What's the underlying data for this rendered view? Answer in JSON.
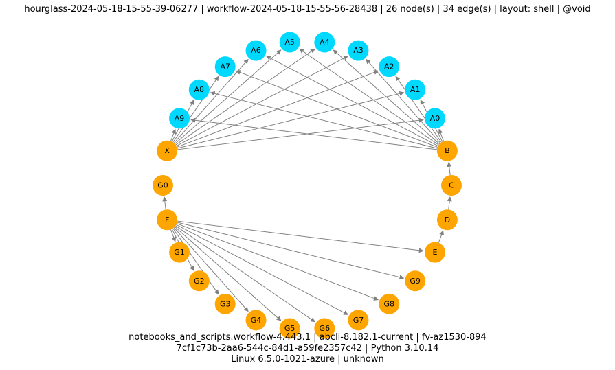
{
  "title": "hourglass-2024-05-18-15-55-39-06277 | workflow-2024-05-18-15-55-56-28438 | 26 node(s) | 34 edge(s) | layout: shell | @void",
  "footer1": "notebooks_and_scripts.workflow-4.443.1 | abcli-8.182.1-current | fv-az1530-894",
  "footer2": "7cf1c73b-2aa6-544c-84d1-a59fe2357c42 | Python 3.10.14",
  "footer3": "Linux 6.5.0-1021-azure | unknown",
  "colors": {
    "cyan": "#00d9ff",
    "orange": "#ffa500",
    "edge": "#808080"
  },
  "chart_data": {
    "type": "table",
    "layout": "shell",
    "node_count": 26,
    "edge_count": 34,
    "nodes": [
      {
        "id": "A4",
        "group": "cyan"
      },
      {
        "id": "A3",
        "group": "cyan"
      },
      {
        "id": "A2",
        "group": "cyan"
      },
      {
        "id": "A1",
        "group": "cyan"
      },
      {
        "id": "A0",
        "group": "cyan"
      },
      {
        "id": "B",
        "group": "orange"
      },
      {
        "id": "C",
        "group": "orange"
      },
      {
        "id": "D",
        "group": "orange"
      },
      {
        "id": "E",
        "group": "orange"
      },
      {
        "id": "G9",
        "group": "orange"
      },
      {
        "id": "G8",
        "group": "orange"
      },
      {
        "id": "G7",
        "group": "orange"
      },
      {
        "id": "G6",
        "group": "orange"
      },
      {
        "id": "G5",
        "group": "orange"
      },
      {
        "id": "G4",
        "group": "orange"
      },
      {
        "id": "G3",
        "group": "orange"
      },
      {
        "id": "G2",
        "group": "orange"
      },
      {
        "id": "G1",
        "group": "orange"
      },
      {
        "id": "F",
        "group": "orange"
      },
      {
        "id": "G0",
        "group": "orange"
      },
      {
        "id": "X",
        "group": "orange"
      },
      {
        "id": "A9",
        "group": "cyan"
      },
      {
        "id": "A8",
        "group": "cyan"
      },
      {
        "id": "A7",
        "group": "cyan"
      },
      {
        "id": "A6",
        "group": "cyan"
      },
      {
        "id": "A5",
        "group": "cyan"
      }
    ],
    "edges": [
      {
        "from": "B",
        "to": "A0"
      },
      {
        "from": "B",
        "to": "A1"
      },
      {
        "from": "B",
        "to": "A2"
      },
      {
        "from": "B",
        "to": "A3"
      },
      {
        "from": "B",
        "to": "A4"
      },
      {
        "from": "B",
        "to": "A5"
      },
      {
        "from": "B",
        "to": "A6"
      },
      {
        "from": "B",
        "to": "A7"
      },
      {
        "from": "B",
        "to": "A8"
      },
      {
        "from": "B",
        "to": "A9"
      },
      {
        "from": "C",
        "to": "B"
      },
      {
        "from": "D",
        "to": "C"
      },
      {
        "from": "E",
        "to": "D"
      },
      {
        "from": "F",
        "to": "E"
      },
      {
        "from": "F",
        "to": "G0"
      },
      {
        "from": "F",
        "to": "G1"
      },
      {
        "from": "F",
        "to": "G2"
      },
      {
        "from": "F",
        "to": "G3"
      },
      {
        "from": "F",
        "to": "G4"
      },
      {
        "from": "F",
        "to": "G5"
      },
      {
        "from": "F",
        "to": "G6"
      },
      {
        "from": "F",
        "to": "G7"
      },
      {
        "from": "F",
        "to": "G8"
      },
      {
        "from": "F",
        "to": "G9"
      },
      {
        "from": "X",
        "to": "A0"
      },
      {
        "from": "X",
        "to": "A1"
      },
      {
        "from": "X",
        "to": "A2"
      },
      {
        "from": "X",
        "to": "A3"
      },
      {
        "from": "X",
        "to": "A4"
      },
      {
        "from": "X",
        "to": "A5"
      },
      {
        "from": "X",
        "to": "A6"
      },
      {
        "from": "X",
        "to": "A7"
      },
      {
        "from": "X",
        "to": "A8"
      },
      {
        "from": "X",
        "to": "A9"
      }
    ]
  }
}
